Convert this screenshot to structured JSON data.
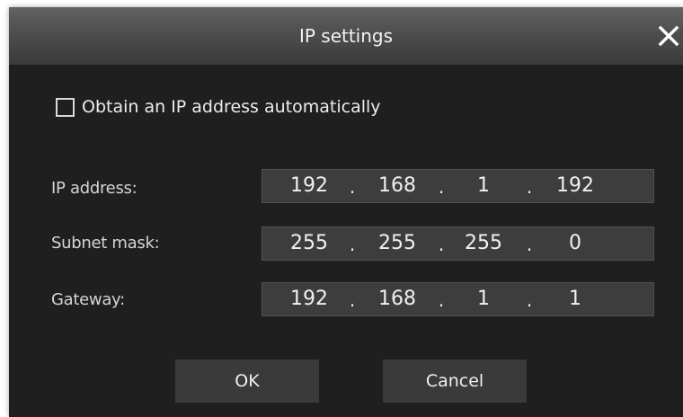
{
  "dialog": {
    "title": "IP settings",
    "close_icon": "close-icon"
  },
  "auto_ip": {
    "label": "Obtain an IP address automatically",
    "checked": false
  },
  "fields": {
    "ip_address": {
      "label": "IP address:",
      "octets": [
        "192",
        "168",
        "1",
        "192"
      ]
    },
    "subnet_mask": {
      "label": "Subnet mask:",
      "octets": [
        "255",
        "255",
        "255",
        "0"
      ]
    },
    "gateway": {
      "label": "Gateway:",
      "octets": [
        "192",
        "168",
        "1",
        "1"
      ]
    },
    "separator": "."
  },
  "buttons": {
    "ok_label": "OK",
    "cancel_label": "Cancel"
  },
  "colors": {
    "dialog_background": "#1f1f1f",
    "titlebar": "#4e4e4e",
    "field_background": "#3d3d3d",
    "button_background": "#3a3a3a",
    "text": "#f0f0f0"
  }
}
